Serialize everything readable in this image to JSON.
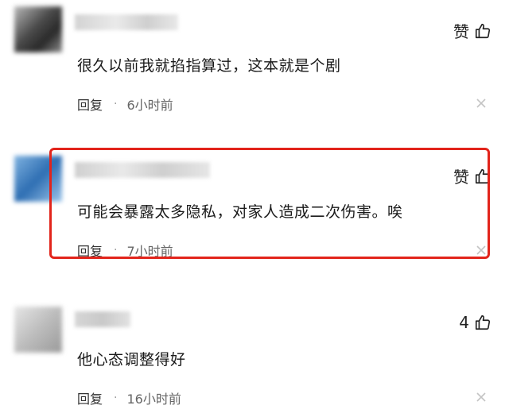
{
  "comments": [
    {
      "like_label": "赞",
      "text": "很久以前我就掐指算过，这本就是个剧",
      "reply_label": "回复",
      "separator": "·",
      "time": "6小时前"
    },
    {
      "like_label": "赞",
      "text": "可能会暴露太多隐私，对家人造成二次伤害。唉",
      "reply_label": "回复",
      "separator": "·",
      "time": "7小时前"
    },
    {
      "like_label": "4",
      "text": "他心态调整得好",
      "reply_label": "回复",
      "separator": "·",
      "time": "16小时前"
    }
  ],
  "colors": {
    "highlight": "#e2241b"
  }
}
